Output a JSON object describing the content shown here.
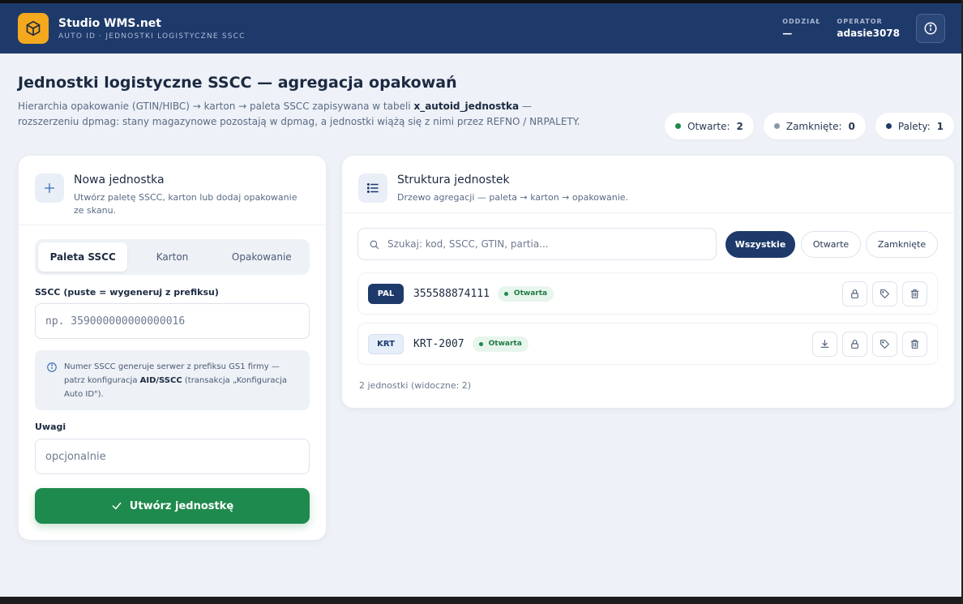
{
  "header": {
    "app_name": "Studio WMS.net",
    "app_sub": "AUTO ID · JEDNOSTKI LOGISTYCZNE SSCC",
    "branch_label": "ODDZIAŁ",
    "branch_value": "—",
    "operator_label": "OPERATOR",
    "operator_value": "adasie3078"
  },
  "page": {
    "title": "Jednostki logistyczne SSCC — agregacja opakowań",
    "desc_part1": "Hierarchia opakowanie (GTIN/HIBC) → karton → paleta SSCC zapisywana w tabeli ",
    "desc_table": "x_autoid_jednostka",
    "desc_part2": " — rozszerzeniu dpmag: stany magazynowe pozostają w dpmag, a jednostki wiążą się z nimi przez REFNO / NRPALETY."
  },
  "stats": [
    {
      "label": "Otwarte:",
      "value": "2",
      "color": "#1f8a4d"
    },
    {
      "label": "Zamknięte:",
      "value": "0",
      "color": "#8a96aa"
    },
    {
      "label": "Palety:",
      "value": "1",
      "color": "#1e3a6b"
    }
  ],
  "new_unit": {
    "title": "Nowa jednostka",
    "subtitle": "Utwórz paletę SSCC, karton lub dodaj opakowanie ze skanu.",
    "tabs": [
      "Paleta SSCC",
      "Karton",
      "Opakowanie"
    ],
    "sscc_label": "SSCC (puste = wygeneruj z prefiksu)",
    "sscc_placeholder": "np. 359000000000000016",
    "note_part1": "Numer SSCC generuje serwer z prefiksu GS1 firmy — patrz konfiguracja ",
    "note_bold": "AID/SSCC",
    "note_part2": " (transakcja „Konfiguracja Auto ID\").",
    "remarks_label": "Uwagi",
    "remarks_placeholder": "opcjonalnie",
    "create_button": "Utwórz jednostkę"
  },
  "structure": {
    "title": "Struktura jednostek",
    "subtitle": "Drzewo agregacji — paleta → karton → opakowanie.",
    "search_placeholder": "Szukaj: kod, SSCC, GTIN, partia...",
    "filters": [
      "Wszystkie",
      "Otwarte",
      "Zamknięte"
    ],
    "units": [
      {
        "type": "PAL",
        "code": "355588874111",
        "status": "Otwarta"
      },
      {
        "type": "KRT",
        "code": "KRT-2007",
        "status": "Otwarta"
      }
    ],
    "count_text": "2 jednostki (widoczne: 2)"
  },
  "icons": {
    "logo": "box-icon",
    "info": "info-icon",
    "plus": "plus-icon",
    "list": "list-icon",
    "search": "search-icon",
    "lock": "lock-icon",
    "tag": "tag-icon",
    "trash": "trash-icon",
    "download": "download-icon",
    "check": "check-icon"
  }
}
